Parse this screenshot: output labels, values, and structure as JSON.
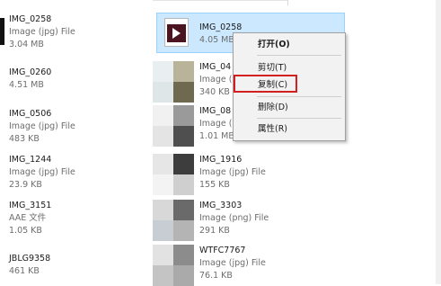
{
  "colors": {
    "selection_bg": "#cce8ff",
    "selection_border": "#99d1ff",
    "highlight": "#d21f1f",
    "menu_bg": "#f2f2f2"
  },
  "left_column": [
    {
      "name": "IMG_0258",
      "type": "Image (jpg) File",
      "size": "3.04 MB"
    },
    {
      "name": "IMG_0260",
      "type": "",
      "size": "4.51 MB"
    },
    {
      "name": "IMG_0506",
      "type": "Image (jpg) File",
      "size": "483 KB"
    },
    {
      "name": "IMG_1244",
      "type": "Image (jpg) File",
      "size": "23.9 KB"
    },
    {
      "name": "IMG_3151",
      "type": "AAE 文件",
      "size": "1.05 KB"
    },
    {
      "name": "JBLG9358",
      "type": "",
      "size": "461 KB"
    }
  ],
  "selected_item": {
    "name": "IMG_0258",
    "size": "4.05 MB",
    "icon": "video-file-icon"
  },
  "right_column": [
    {
      "name": "IMG_04",
      "type": "Image (",
      "size": "340 KB"
    },
    {
      "name": "IMG_08",
      "type": "Image (",
      "size": "1.01 MB"
    },
    {
      "name": "IMG_1916",
      "type": "Image (jpg) File",
      "size": "155 KB"
    },
    {
      "name": "IMG_3303",
      "type": "Image (png) File",
      "size": "291 KB"
    },
    {
      "name": "WTFC7767",
      "type": "Image (jpg) File",
      "size": "76.1 KB"
    }
  ],
  "context_menu": {
    "open": "打开(O)",
    "cut": "剪切(T)",
    "copy": "复制(C)",
    "delete": "删除(D)",
    "properties": "属性(R)"
  }
}
